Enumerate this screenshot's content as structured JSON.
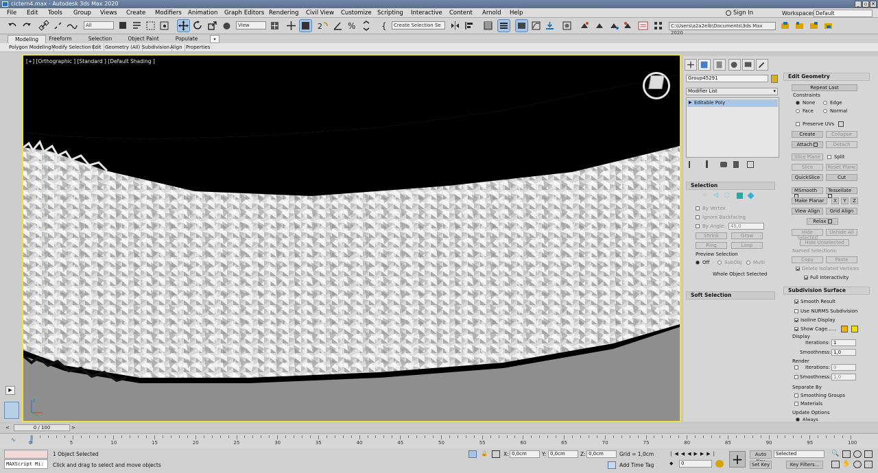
{
  "window": {
    "title": "cictern4.max - Autodesk 3ds Max 2020",
    "buttons": [
      "_",
      "▫",
      "✕"
    ]
  },
  "menu": {
    "items": [
      "File",
      "Edit",
      "Tools",
      "Group",
      "Views",
      "Create",
      "Modifiers",
      "Animation",
      "Graph Editors",
      "Rendering",
      "Civil View",
      "Customize",
      "Scripting",
      "Interactive",
      "Content",
      "Arnold",
      "Help"
    ],
    "signin": "Sign In",
    "workspaces_label": "Workspaces:",
    "workspace": "Default"
  },
  "toolbar": {
    "filter": "All",
    "refcoord": "View",
    "selection_set": "Create Selection Se",
    "project_path": "C:\\Users\\a2a2elb\\Documents\\3ds Max 2020"
  },
  "ribbon": {
    "tabs": [
      "Modeling",
      "Freeform",
      "Selection",
      "Object Paint",
      "Populate"
    ],
    "subtabs": [
      "Polygon Modeling",
      "Modify Selection",
      "Edit",
      "Geometry (All)",
      "Subdivision",
      "Align",
      "Properties"
    ]
  },
  "viewport": {
    "label": "[+] [Orthographic ] [Standard ] [Default Shading ]",
    "accent": "#f0e23b"
  },
  "panel": {
    "object_name": "Group45291",
    "object_color": "#d6b020",
    "modifier_list": "Modifier List",
    "stack_item": "Editable Poly",
    "selection": {
      "title": "Selection",
      "by_vertex": "By Vertex",
      "ignore_backfacing": "Ignore Backfacing",
      "by_angle": "By Angle:",
      "angle": "45,0",
      "shrink": "Shrink",
      "grow": "Grow",
      "ring": "Ring",
      "loop": "Loop",
      "preview": "Preview Selection",
      "off": "Off",
      "subobj": "SubObj",
      "multi": "Multi",
      "status": "Whole Object Selected"
    },
    "soft_selection": "Soft Selection",
    "edit_geometry": {
      "title": "Edit Geometry",
      "repeat_last": "Repeat Last",
      "constraints": "Constraints",
      "none": "None",
      "edge": "Edge",
      "face": "Face",
      "normal": "Normal",
      "preserve_uvs": "Preserve UVs",
      "create": "Create",
      "collapse": "Collapse",
      "attach": "Attach",
      "detach": "Detach",
      "slice_plane": "Slice Plane",
      "split": "Split",
      "slice": "Slice",
      "reset_plane": "Reset Plane",
      "quickslice": "QuickSlice",
      "cut": "Cut",
      "msmooth": "MSmooth",
      "tessellate": "Tessellate",
      "make_planar": "Make Planar",
      "x": "X",
      "y": "Y",
      "z": "Z",
      "view_align": "View Align",
      "grid_align": "Grid Align",
      "relax": "Relax",
      "hide_selected": "Hide Selected",
      "unhide_all": "Unhide All",
      "hide_unselected": "Hide Unselected",
      "named_selections": "Named Selections:",
      "copy": "Copy",
      "paste": "Paste",
      "delete_isolated": "Delete Isolated Vertices",
      "full_interactivity": "Full Interactivity"
    },
    "subdivision": {
      "title": "Subdivision Surface",
      "smooth_result": "Smooth Result",
      "use_nurms": "Use NURMS Subdivision",
      "isoline": "Isoline Display",
      "show_cage": "Show Cage......",
      "display": "Display",
      "iterations_label": "Iterations:",
      "iterations": "1",
      "smoothness_label": "Smoothness:",
      "smoothness": "1,0",
      "render": "Render",
      "r_iterations": "0",
      "r_smoothness": "1,0",
      "separate_by": "Separate By",
      "smoothing_groups": "Smoothing Groups",
      "materials": "Materials",
      "update_options": "Update Options",
      "always": "Always",
      "cage_color1": "#f3b400",
      "cage_color2": "#f3dc00"
    }
  },
  "timeline": {
    "frame": "0 / 100",
    "ticks": [
      "0",
      "5",
      "10",
      "15",
      "20",
      "25",
      "30",
      "35",
      "40",
      "45",
      "50",
      "55",
      "60",
      "65",
      "70",
      "75",
      "80",
      "85",
      "90",
      "95",
      "100"
    ]
  },
  "status": {
    "maxscript": "MAXScript Mi:",
    "objects_selected": "1 Object Selected",
    "prompt": "Click and drag to select and move objects",
    "x_label": "X:",
    "x": "0,0cm",
    "y_label": "Y:",
    "y": "0,0cm",
    "z_label": "Z:",
    "z": "0,0cm",
    "grid": "Grid = 1,0cm",
    "add_time_tag": "Add Time Tag",
    "auto_key": "Auto Key",
    "selected": "Selected",
    "set_key": "Set Key",
    "key_filters": "Key Filters...",
    "frame": "0"
  }
}
